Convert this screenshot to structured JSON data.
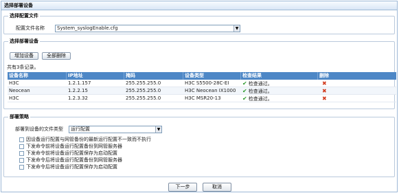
{
  "title": "选择部署设备",
  "config_section": {
    "legend": "选择配置文件",
    "file_label": "配置文件名称",
    "file_value": "System_syslogEnable.cfg"
  },
  "device_section": {
    "legend": "选择部署设备",
    "add_button": "增加设备",
    "delete_all_button": "全部删除",
    "record_count": "共有3条记录。",
    "columns": [
      "设备名称",
      "IP地址",
      "掩码",
      "设备类型",
      "检查结果",
      "删除"
    ],
    "rows": [
      {
        "name": "H3C",
        "ip": "1.2.1.157",
        "mask": "255.255.255.0",
        "type": "H3C S5500-28C-EI",
        "result": "检查通过。"
      },
      {
        "name": "Neocean",
        "ip": "1.2.2.15",
        "mask": "255.255.255.0",
        "type": "H3C Neocean IX1000",
        "result": "检查通过。"
      },
      {
        "name": "H3C",
        "ip": "1.2.3.32",
        "mask": "255.255.255.0",
        "type": "H3C MSR20-13",
        "result": "检查通过。"
      }
    ],
    "result_icon": "check-icon",
    "delete_icon": "delete-x-icon"
  },
  "strategy_section": {
    "legend": "部署策略",
    "file_type_label": "部署到设备的文件类型",
    "file_type_value": "运行配置",
    "options": [
      "因设备运行配置与网管备份的最新运行配置不一致而不执行",
      "下发命令前将设备运行配置备份到网管服务器",
      "下发命令前将设备运行配置保存为启动配置",
      "下发命令后将设备运行配置备份到网管服务器",
      "下发命令后将设备运行配置保存为启动配置"
    ]
  },
  "footer": {
    "next_button": "下一步",
    "cancel_button": "取消"
  },
  "colors": {
    "header_blue": "#4d87c6",
    "check_green": "#2e9a2e",
    "delete_red": "#d23b1e"
  }
}
